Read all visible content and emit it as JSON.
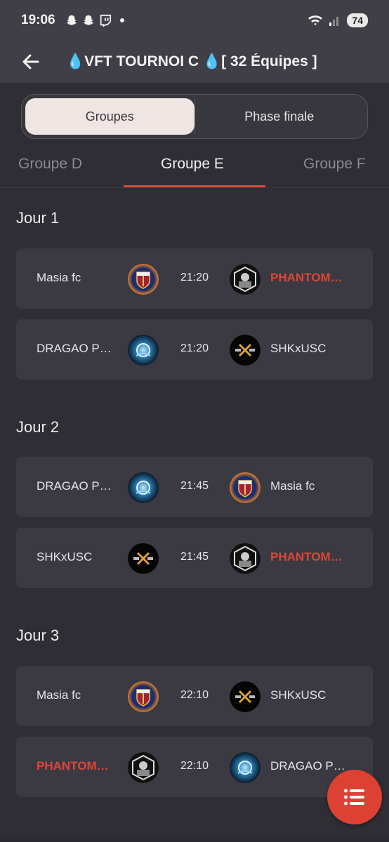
{
  "status_bar": {
    "time": "19:06",
    "battery": "74"
  },
  "app_bar": {
    "title": "💧VFT TOURNOI C 💧[ 32 Équipes ]"
  },
  "segment": {
    "groups_label": "Groupes",
    "final_label": "Phase finale"
  },
  "group_tabs": {
    "prev": "Groupe D",
    "current": "Groupe E",
    "next": "Groupe F"
  },
  "days": [
    {
      "title": "Jour 1",
      "matches": [
        {
          "home": "Masia fc",
          "home_logo": "barca-logo",
          "time": "21:20",
          "away": "PHANTOM…",
          "away_logo": "phantom-logo",
          "home_highlight": false,
          "away_highlight": true
        },
        {
          "home": "DRAGAO P…",
          "home_logo": "dragao-logo",
          "time": "21:20",
          "away": "SHKxUSC",
          "away_logo": "shk-logo",
          "home_highlight": false,
          "away_highlight": false
        }
      ]
    },
    {
      "title": "Jour 2",
      "matches": [
        {
          "home": "DRAGAO P…",
          "home_logo": "dragao-logo",
          "time": "21:45",
          "away": "Masia fc",
          "away_logo": "barca-logo",
          "home_highlight": false,
          "away_highlight": false
        },
        {
          "home": "SHKxUSC",
          "home_logo": "shk-logo",
          "time": "21:45",
          "away": "PHANTOM…",
          "away_logo": "phantom-logo",
          "home_highlight": false,
          "away_highlight": true
        }
      ]
    },
    {
      "title": "Jour 3",
      "matches": [
        {
          "home": "Masia fc",
          "home_logo": "barca-logo",
          "time": "22:10",
          "away": "SHKxUSC",
          "away_logo": "shk-logo",
          "home_highlight": false,
          "away_highlight": false
        },
        {
          "home": "PHANTOM…",
          "home_logo": "phantom-logo",
          "time": "22:10",
          "away": "DRAGAO P…",
          "away_logo": "dragao-logo",
          "home_highlight": true,
          "away_highlight": false
        }
      ]
    }
  ],
  "colors": {
    "accent": "#dd4134",
    "background": "#2f2e35",
    "card": "#3b3a42",
    "highlight_text": "#e04535"
  },
  "fab": {
    "icon": "list-icon"
  }
}
